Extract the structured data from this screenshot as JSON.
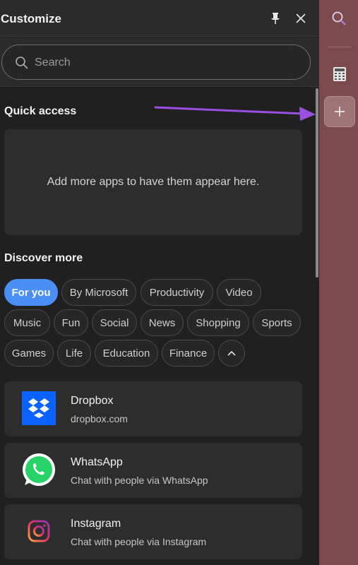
{
  "header": {
    "title": "Customize"
  },
  "search": {
    "placeholder": "Search"
  },
  "quick_access": {
    "title": "Quick access",
    "empty_message": "Add more apps to have them appear here."
  },
  "discover": {
    "title": "Discover more",
    "chips": [
      "For you",
      "By Microsoft",
      "Productivity",
      "Video",
      "Music",
      "Fun",
      "Social",
      "News",
      "Shopping",
      "Sports",
      "Games",
      "Life",
      "Education",
      "Finance"
    ],
    "active_chip": "For you"
  },
  "apps": [
    {
      "name": "Dropbox",
      "desc": "dropbox.com",
      "icon": "dropbox-icon"
    },
    {
      "name": "WhatsApp",
      "desc": "Chat with people via WhatsApp",
      "icon": "whatsapp-icon"
    },
    {
      "name": "Instagram",
      "desc": "Chat with people via Instagram",
      "icon": "instagram-icon"
    }
  ],
  "sidebar_icons": [
    "search-icon",
    "calculator-icon",
    "add-icon"
  ],
  "colors": {
    "accent": "#4a8ff5",
    "sidebar": "#7b4b4b",
    "arrow": "#9b4fe0"
  }
}
